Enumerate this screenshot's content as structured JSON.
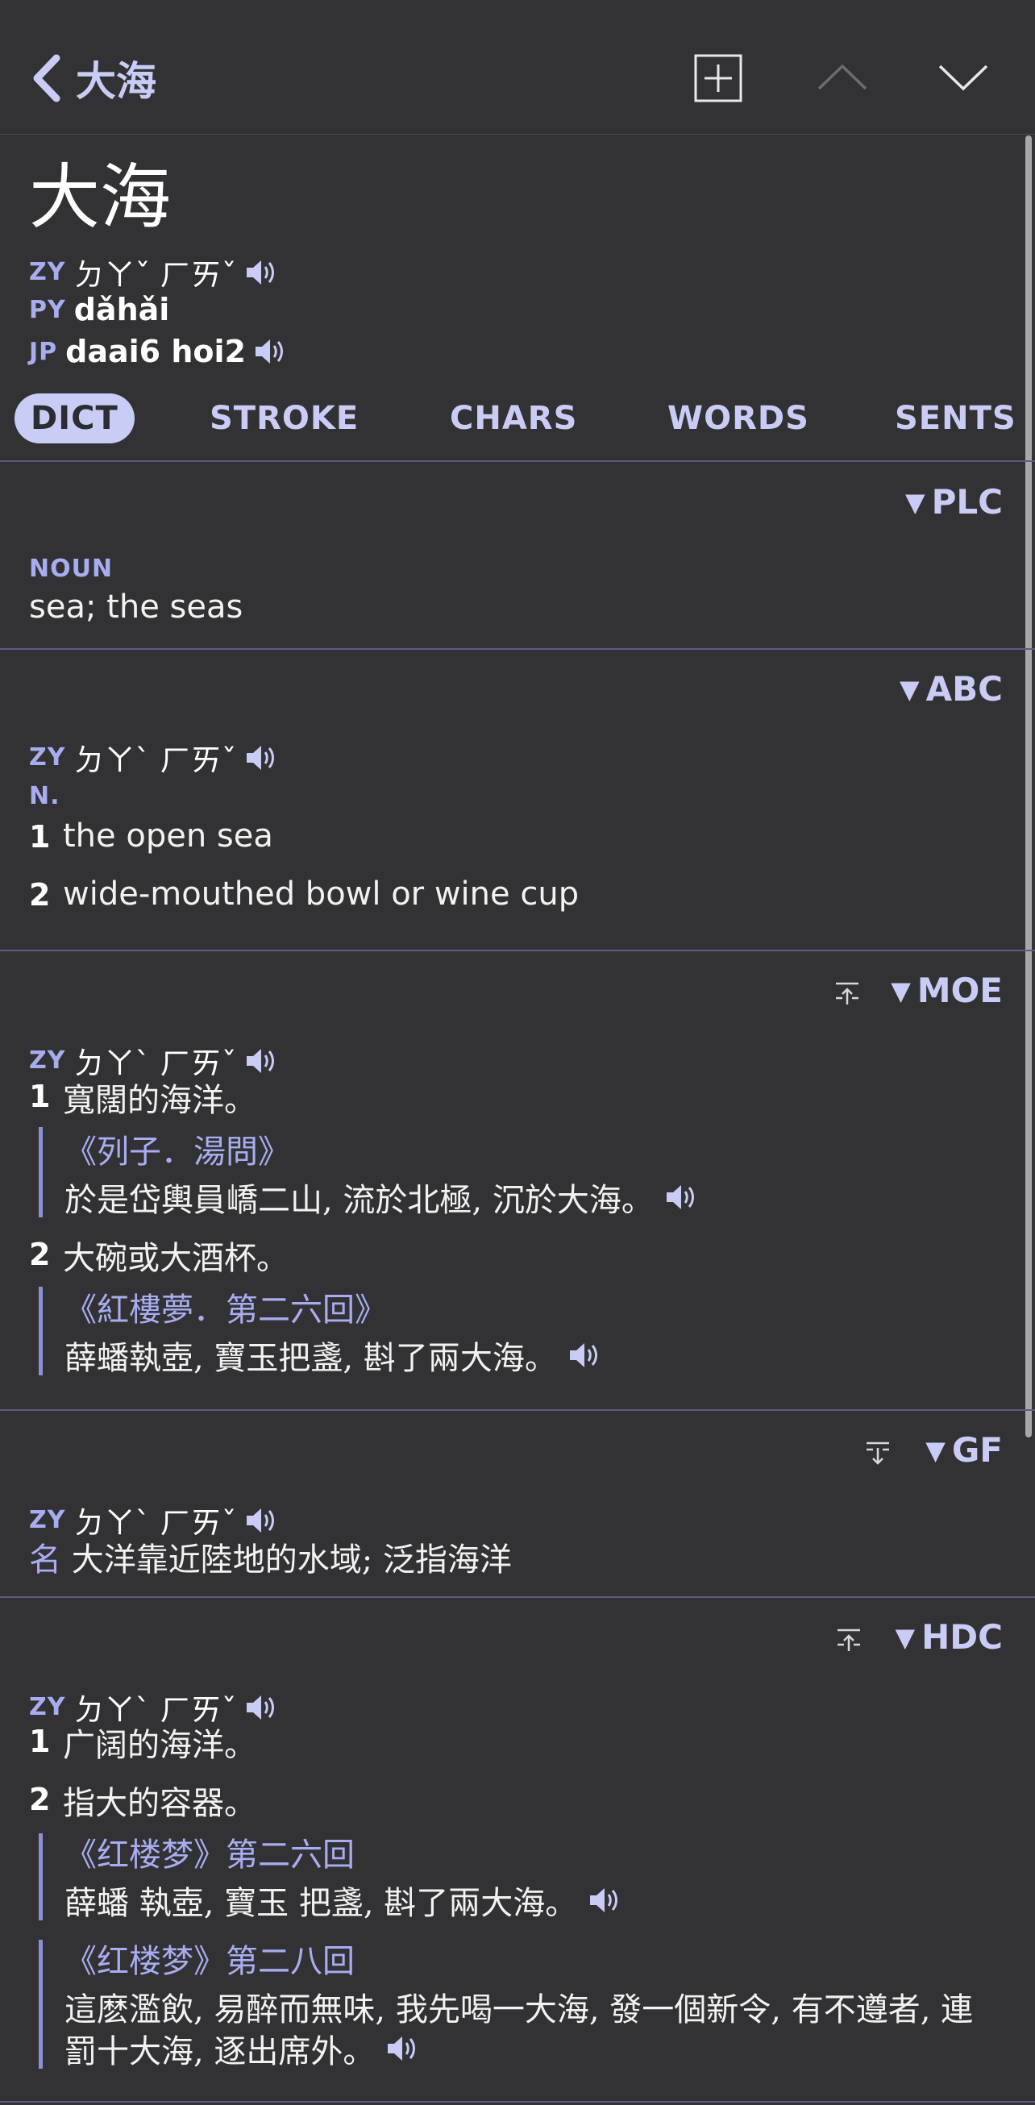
{
  "topbar": {
    "title": "大海",
    "icons": [
      "back-chevron-icon",
      "add-box-icon",
      "chevron-up-icon",
      "chevron-down-icon"
    ]
  },
  "entry": {
    "headword": "大海",
    "zy_tag": "ZY",
    "zhuyin": "ㄉㄚˇ ㄏㄞˇ",
    "py_tag": "PY",
    "pinyin": "dǎhǎi",
    "jp_tag": "JP",
    "jyutping": "daai6 hoi2"
  },
  "tabs": [
    {
      "label": "DICT",
      "active": true
    },
    {
      "label": "STROKE",
      "active": false
    },
    {
      "label": "CHARS",
      "active": false
    },
    {
      "label": "WORDS",
      "active": false
    },
    {
      "label": "SENTS",
      "active": false
    }
  ],
  "sections": {
    "plc": {
      "label": "PLC",
      "pos": "NOUN",
      "definition": "sea; the seas"
    },
    "abc": {
      "label": "ABC",
      "zy_tag": "ZY",
      "zhuyin": "ㄉㄚˋ ㄏㄞˇ",
      "pos": "N.",
      "defs": [
        {
          "num": "1",
          "text": "the open sea"
        },
        {
          "num": "2",
          "text": "wide-mouthed bowl or wine cup"
        }
      ]
    },
    "moe": {
      "label": "MOE",
      "zy_tag": "ZY",
      "zhuyin": "ㄉㄚˋ ㄏㄞˇ",
      "defs": [
        {
          "num": "1",
          "text": "寬闊的海洋。",
          "source": "《列子．湯問》",
          "quote": "於是岱輿員嶠二山, 流於北極, 沉於大海。"
        },
        {
          "num": "2",
          "text": "大碗或大酒杯。",
          "source": "《紅樓夢．第二六回》",
          "quote": "薛蟠執壺, 寶玉把盞, 斟了兩大海。"
        }
      ]
    },
    "gf": {
      "label": "GF",
      "zy_tag": "ZY",
      "zhuyin": "ㄉㄚˋ ㄏㄞˇ",
      "pos": "名",
      "definition": "大洋靠近陸地的水域; 泛指海洋"
    },
    "hdc": {
      "label": "HDC",
      "zy_tag": "ZY",
      "zhuyin": "ㄉㄚˋ ㄏㄞˇ",
      "defs": [
        {
          "num": "1",
          "text": "广阔的海洋。"
        },
        {
          "num": "2",
          "text": "指大的容器。"
        }
      ],
      "quotes": [
        {
          "source": "《红楼梦》第二六回",
          "lines": [
            "薛蟠 執壺, 寶玉 把盞, 斟了兩大海。"
          ]
        },
        {
          "source": "《红楼梦》第二八回",
          "lines": [
            "這麽濫飲, 易醉而無味, 我先喝一大海, 發一個新令, 有不遵者, 連",
            "罰十大海, 逐出席外。"
          ]
        }
      ]
    }
  },
  "colors": {
    "background": "#323234",
    "accent": "#c9cdf6",
    "tag": "#a8adf0",
    "separator": "#5a5b86"
  }
}
